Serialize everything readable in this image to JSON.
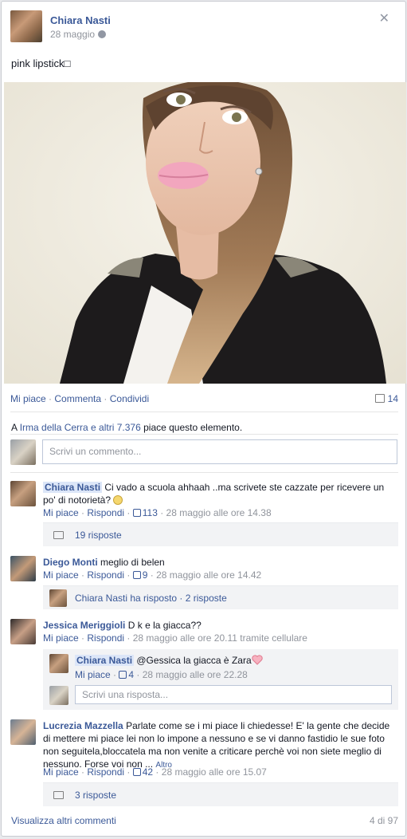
{
  "post": {
    "author": "Chiara Nasti",
    "date": "28 maggio",
    "caption": "pink lipstick□"
  },
  "actions": {
    "like": "Mi piace",
    "comment": "Commenta",
    "share": "Condividi",
    "comment_count": "14"
  },
  "likes": {
    "prefix": "A",
    "names": "Irma della Cerra e altri 7.376",
    "suffix": "piace questo elemento."
  },
  "composer": {
    "placeholder": "Scrivi un commento..."
  },
  "comments": [
    {
      "author": "Chiara Nasti",
      "text": "Ci vado a scuola ahhaah ..ma scrivete ste cazzate per ricevere un po' di notorietà?",
      "like": "Mi piace",
      "reply": "Rispondi",
      "likes": "113",
      "time": "28 maggio alle ore 14.38",
      "replies_text": "19 risposte"
    },
    {
      "author": "Diego Monti",
      "text": "meglio di belen",
      "like": "Mi piace",
      "reply": "Rispondi",
      "likes": "9",
      "time": "28 maggio alle ore 14.42",
      "replies_author": "Chiara Nasti",
      "replies_action": "ha risposto",
      "replies_count": "2 risposte"
    },
    {
      "author": "Jessica Meriggioli",
      "text": "D k e la giacca??",
      "like": "Mi piace",
      "reply": "Rispondi",
      "time": "28 maggio alle ore 20.11 tramite cellulare",
      "reply_item": {
        "author": "Chiara Nasti",
        "text": "@Gessica la giacca è Zara",
        "like": "Mi piace",
        "likes": "4",
        "time": "28 maggio alle ore 22.28"
      },
      "reply_placeholder": "Scrivi una risposta..."
    },
    {
      "author": "Lucrezia Mazzella",
      "text": "Parlate come se i mi piace li chiedesse! E' la gente che decide di mettere mi piace lei non lo impone a nessuno e se vi danno fastidio le sue foto non seguitela,bloccatela ma non venite a criticare perchè voi non siete meglio di nessuno. Forse voi non ...",
      "more": "Altro",
      "like": "Mi piace",
      "reply": "Rispondi",
      "likes": "42",
      "time": "28 maggio alle ore 15.07",
      "replies_text": "3 risposte"
    }
  ],
  "footer": {
    "more": "Visualizza altri commenti",
    "count": "4 di 97"
  },
  "colors": {
    "link": "#3b5998",
    "lipstick": "#f2a6be"
  }
}
